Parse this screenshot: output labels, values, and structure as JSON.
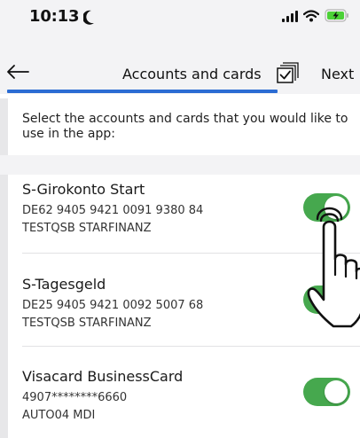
{
  "status_bar": {
    "time": "10:13"
  },
  "nav": {
    "title": "Accounts and cards",
    "next_label": "Next",
    "progress_fraction": 0.75
  },
  "intro_text": "Select the accounts and cards that you would like to use in the app:",
  "accounts": [
    {
      "name": "S-Girokonto Start",
      "number": "DE62 9405 9421 0091 9380 84",
      "holder": "TESTQSB STARFINANZ",
      "enabled": true
    },
    {
      "name": "S-Tagesgeld",
      "number": "DE25 9405 9421 0092 5007 68",
      "holder": "TESTQSB STARFINANZ",
      "enabled": true
    },
    {
      "name": "Visacard BusinessCard",
      "number": "4907********6660",
      "holder": "AUTO04 MDI",
      "enabled": true
    }
  ],
  "colors": {
    "toggle_on": "#46a84e",
    "progress": "#2b6cd3",
    "bar_background": "#f3f3f5"
  },
  "icons": [
    "moon-icon",
    "signal-icon",
    "wifi-icon",
    "battery-charging-icon",
    "back-arrow-icon",
    "select-all-icon",
    "pointing-hand-icon"
  ]
}
